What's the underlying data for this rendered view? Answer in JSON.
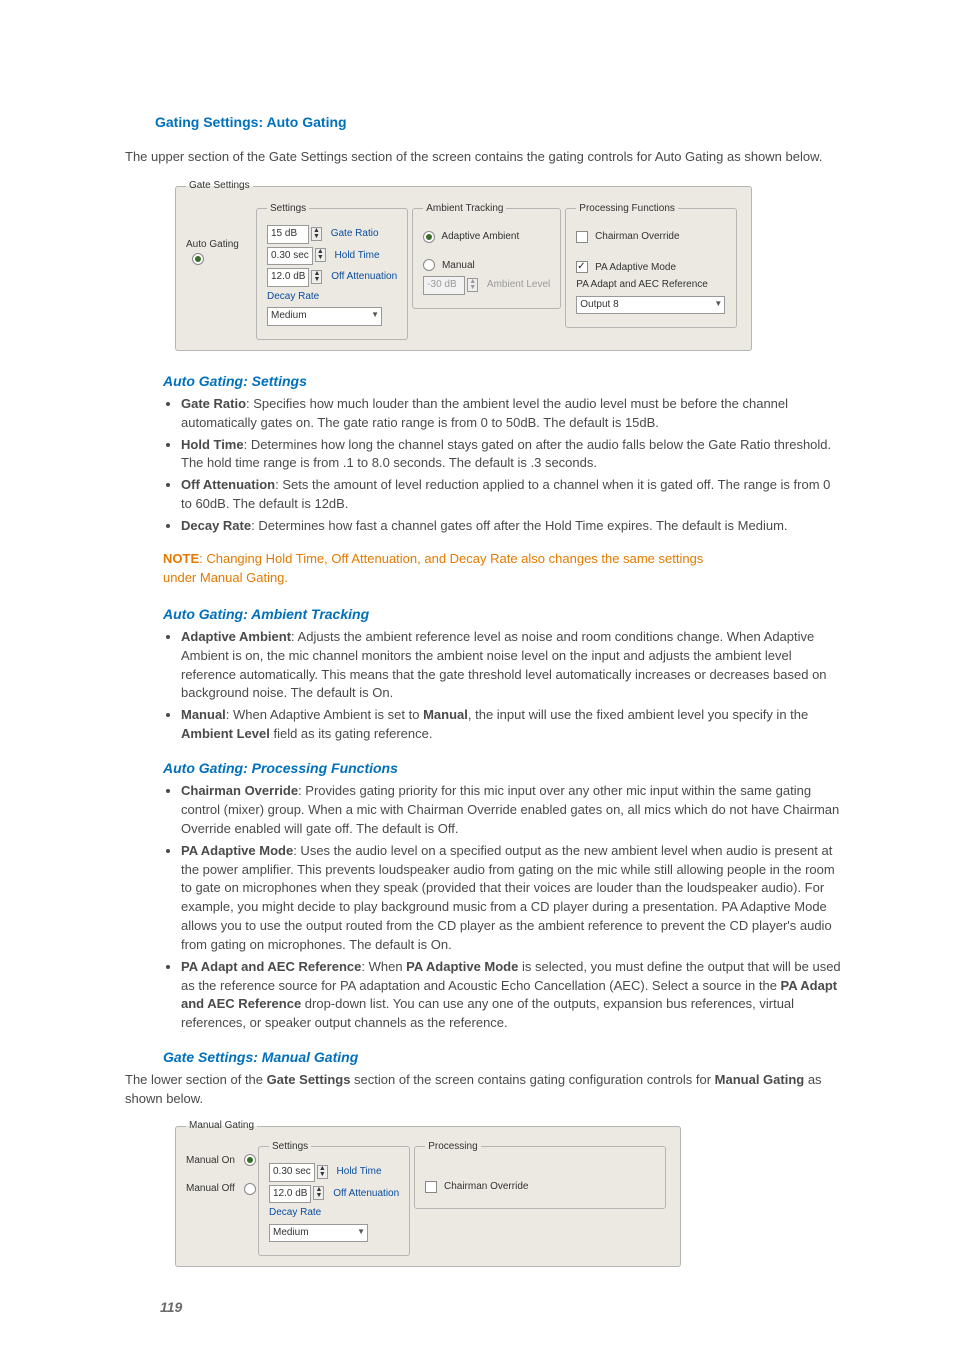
{
  "title": "Gating Settings: Auto Gating",
  "intro": "The upper section of the Gate Settings section of the screen contains the gating controls for Auto Gating as shown below.",
  "fig1": {
    "outer_legend": "Gate Settings",
    "mode_label": "Auto Gating",
    "settings_legend": "Settings",
    "gate_ratio_value": "15 dB",
    "gate_ratio_label": "Gate Ratio",
    "hold_time_value": "0.30 sec",
    "hold_time_label": "Hold Time",
    "off_atten_value": "12.0 dB",
    "off_atten_label": "Off Attenuation",
    "decay_label": "Decay Rate",
    "decay_value": "Medium",
    "ambient_legend": "Ambient Tracking",
    "adaptive_label": "Adaptive Ambient",
    "manual_label": "Manual",
    "ambient_level_value": "-30 dB",
    "ambient_level_label": "Ambient Level",
    "proc_legend": "Processing Functions",
    "chairman_label": "Chairman Override",
    "pa_mode_label": "PA Adaptive Mode",
    "pa_ref_label": "PA Adapt and AEC Reference",
    "pa_ref_value": "Output 8"
  },
  "sec1": {
    "heading": "Auto Gating: Settings",
    "b1_term": "Gate Ratio",
    "b1_text": ": Specifies how much louder than the ambient level the audio level must be before the channel automatically gates on. The gate ratio range is from 0 to 50dB. The default is 15dB.",
    "b2_term": "Hold Time",
    "b2_text": ": Determines how long the channel stays gated on after the audio falls below the Gate Ratio threshold. The hold time range is from .1 to 8.0 seconds. The default is .3 seconds.",
    "b3_term": "Off Attenuation",
    "b3_text": ": Sets the amount of level reduction applied to a channel when it is gated off. The range is from 0 to 60dB. The default is 12dB.",
    "b4_term": "Decay Rate",
    "b4_text": ": Determines how fast a channel gates off after the Hold Time expires. The default is Medium."
  },
  "note": {
    "label": "NOTE",
    "text": ": Changing Hold Time, Off Attenuation, and Decay Rate also changes the same settings under Manual Gating."
  },
  "sec2": {
    "heading": "Auto Gating: Ambient Tracking",
    "b1_term": "Adaptive Ambient",
    "b1_text": ": Adjusts the ambient reference level as noise and room conditions change. When Adaptive Ambient is on, the mic channel monitors the ambient noise level on the input and adjusts the ambient level reference automatically. This means that the gate threshold level automatically increases or decreases based on background noise. The default is On.",
    "b2_term": "Manual",
    "b2_pre": ": When Adaptive Ambient is set to ",
    "b2_bold": "Manual",
    "b2_mid": ", the input will use the fixed ambient level you specify in the ",
    "b2_bold2": "Ambient Level",
    "b2_post": " field as its gating reference."
  },
  "sec3": {
    "heading": "Auto Gating: Processing Functions",
    "b1_term": "Chairman Override",
    "b1_text": ": Provides gating priority for this mic input over any other mic input within the same gating control (mixer) group. When a mic with Chairman Override enabled gates on, all mics which do not have Chairman Override enabled will gate off. The default is Off.",
    "b2_term": "PA Adaptive Mode",
    "b2_text": ": Uses the audio level on a specified output as the new ambient level when audio is present at the power amplifier. This prevents loudspeaker audio from gating on the mic while still allowing people in the room to gate on microphones when they speak (provided that their voices are louder than the loudspeaker audio). For example, you might decide to play background music from a CD player during a presentation. PA Adaptive Mode allows you to use the output routed from the CD player as the ambient reference to prevent the CD player's audio from gating on microphones. The default is On.",
    "b3_term": "PA Adapt and AEC Reference",
    "b3_pre": ": When ",
    "b3_bold1": "PA Adaptive Mode",
    "b3_mid": " is selected, you must define the output that will be used as the reference source for PA adaptation and Acoustic Echo Cancellation (AEC). Select a source in the ",
    "b3_bold2": "PA Adapt and AEC Reference",
    "b3_post": " drop-down list. You can use any one of the outputs, expansion bus references, virtual references, or speaker output channels as the reference."
  },
  "sec4": {
    "heading": "Gate Settings: Manual Gating",
    "intro_pre": "The lower section of the ",
    "intro_b1": "Gate Settings",
    "intro_mid": " section of the screen contains gating configuration controls for ",
    "intro_b2": "Manual Gating",
    "intro_post": " as shown below."
  },
  "fig2": {
    "outer_legend": "Manual Gating",
    "on_label": "Manual On",
    "off_label": "Manual Off",
    "settings_legend": "Settings",
    "hold_time_value": "0.30 sec",
    "hold_time_label": "Hold Time",
    "off_atten_value": "12.0 dB",
    "off_atten_label": "Off Attenuation",
    "decay_label": "Decay Rate",
    "decay_value": "Medium",
    "proc_legend": "Processing",
    "chairman_label": "Chairman Override"
  },
  "page_number": "119"
}
